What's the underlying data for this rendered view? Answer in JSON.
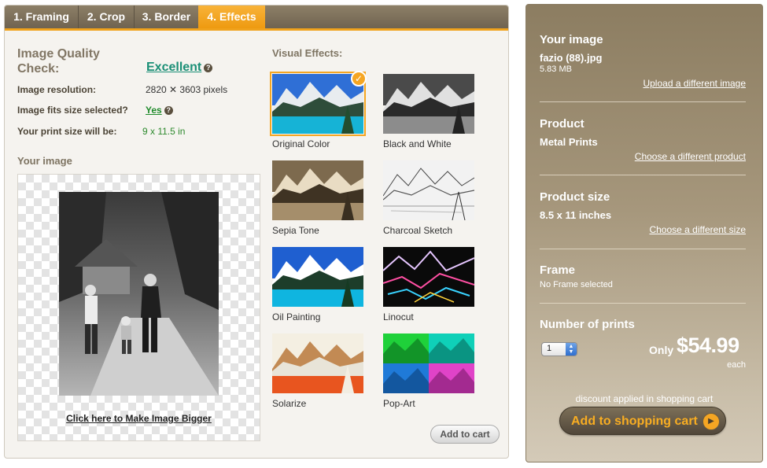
{
  "tabs": [
    {
      "label": "1. Framing"
    },
    {
      "label": "2. Crop"
    },
    {
      "label": "3. Border"
    },
    {
      "label": "4. Effects",
      "active": true
    }
  ],
  "quality": {
    "title": "Image Quality Check:",
    "value": "Excellent",
    "resolution_label": "Image resolution:",
    "resolution_value": "2820 ✕ 3603 pixels",
    "fits_label": "Image fits size selected?",
    "fits_value": "Yes",
    "print_size_label": "Your print size will be:",
    "print_size_value": "9 x 11.5 in"
  },
  "preview": {
    "title": "Your image",
    "bigger_link": "Click here to Make Image Bigger"
  },
  "effects": {
    "title": "Visual Effects:",
    "selected": "Original Color",
    "items": [
      {
        "label": "Original Color"
      },
      {
        "label": "Black and White"
      },
      {
        "label": "Sepia Tone"
      },
      {
        "label": "Charcoal Sketch"
      },
      {
        "label": "Oil Painting"
      },
      {
        "label": "Linocut"
      },
      {
        "label": "Solarize"
      },
      {
        "label": "Pop-Art"
      }
    ],
    "add_to_cart_label": "Add to cart"
  },
  "summary": {
    "image_heading": "Your image",
    "file_name": "fazio (88).jpg",
    "file_size": "5.83 MB",
    "upload_link": "Upload a different image",
    "product_heading": "Product",
    "product_value": "Metal Prints",
    "product_link": "Choose a different product",
    "size_heading": "Product size",
    "size_value": "8.5 x 11 inches",
    "size_link": "Choose a different size",
    "frame_heading": "Frame",
    "frame_value": "No Frame selected",
    "prints_heading": "Number of prints",
    "quantity": "1",
    "only_label": "Only",
    "price": "$54.99",
    "each_label": "each",
    "discount_note": "discount applied in shopping cart",
    "cart_button": "Add to shopping cart"
  },
  "colors": {
    "accent_orange": "#f4a623",
    "tab_brown": "#7d705b",
    "quality_green": "#1a8f76",
    "panel_brown": "#9a8b70"
  },
  "icons": {
    "help": "help-icon",
    "selected": "check-icon",
    "qty_spinner": "up-down-arrows-icon",
    "cart_arrow": "play-arrow-icon"
  }
}
